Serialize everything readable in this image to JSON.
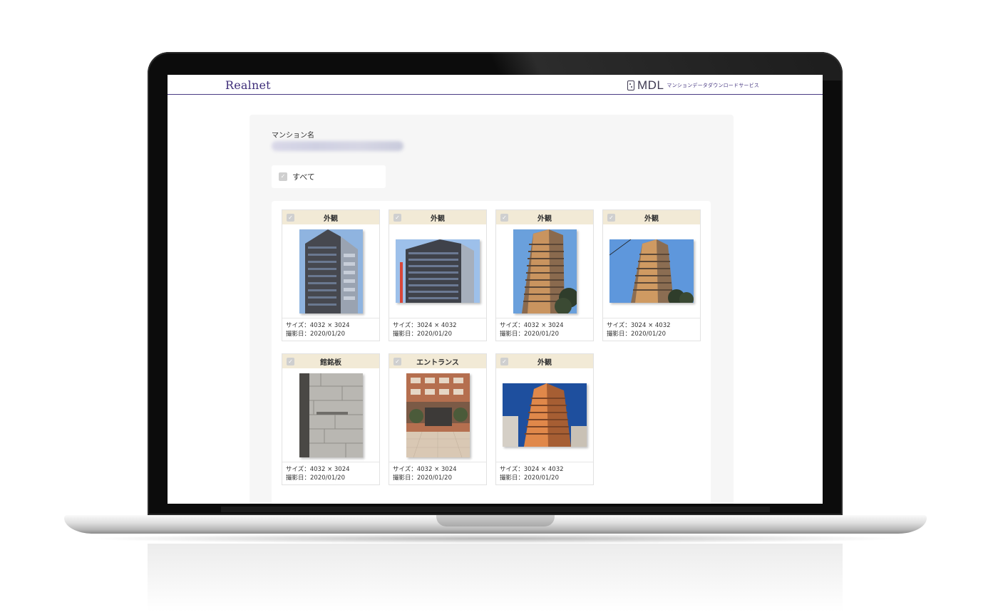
{
  "header": {
    "brand": "Realnet",
    "service_name": "MDL",
    "service_subtitle": "マンションデータダウンロードサービス"
  },
  "form": {
    "mansion_label": "マンション名",
    "mansion_value": "",
    "select_all_label": "すべて"
  },
  "photos": [
    {
      "category": "外観",
      "size": "サイズ：4032 × 3024",
      "date": "撮影日：2020/01/20"
    },
    {
      "category": "外観",
      "size": "サイズ：3024 × 4032",
      "date": "撮影日：2020/01/20"
    },
    {
      "category": "外観",
      "size": "サイズ：4032 × 3024",
      "date": "撮影日：2020/01/20"
    },
    {
      "category": "外観",
      "size": "サイズ：3024 × 4032",
      "date": "撮影日：2020/01/20"
    },
    {
      "category": "館銘板",
      "size": "サイズ：4032 × 3024",
      "date": "撮影日：2020/01/20"
    },
    {
      "category": "エントランス",
      "size": "サイズ：4032 × 3024",
      "date": "撮影日：2020/01/20"
    },
    {
      "category": "外観",
      "size": "サイズ：3024 × 4032",
      "date": "撮影日：2020/01/20"
    }
  ],
  "colors": {
    "brand_purple": "#3f2e7a",
    "card_header": "#f2ead6",
    "panel_bg": "#f6f6f6"
  }
}
